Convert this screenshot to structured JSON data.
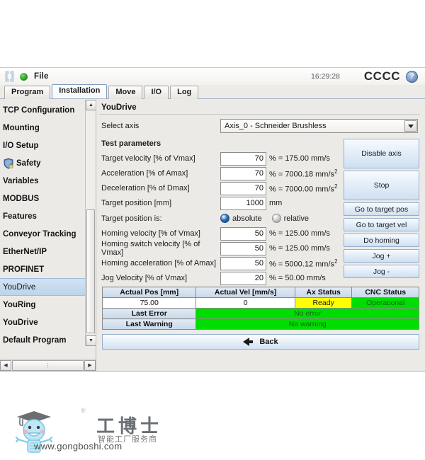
{
  "titlebar": {
    "file_menu": "File",
    "clock": "16:29:28",
    "brand": "CCCC",
    "help_glyph": "?"
  },
  "tabs": [
    {
      "label": "Program",
      "active": false
    },
    {
      "label": "Installation",
      "active": true
    },
    {
      "label": "Move",
      "active": false
    },
    {
      "label": "I/O",
      "active": false
    },
    {
      "label": "Log",
      "active": false
    }
  ],
  "sidebar": {
    "items": [
      {
        "label": "TCP Configuration",
        "icon": "",
        "selected": false
      },
      {
        "label": "Mounting",
        "icon": "",
        "selected": false
      },
      {
        "label": "I/O Setup",
        "icon": "",
        "selected": false
      },
      {
        "label": "Safety",
        "icon": "shield-lock-icon",
        "selected": false
      },
      {
        "label": "Variables",
        "icon": "",
        "selected": false
      },
      {
        "label": "MODBUS",
        "icon": "",
        "selected": false
      },
      {
        "label": "Features",
        "icon": "",
        "selected": false
      },
      {
        "label": "Conveyor Tracking",
        "icon": "",
        "selected": false
      },
      {
        "label": "EtherNet/IP",
        "icon": "",
        "selected": false
      },
      {
        "label": "PROFINET",
        "icon": "",
        "selected": false
      },
      {
        "label": "YouDrive",
        "icon": "",
        "selected": true
      },
      {
        "label": "YouRing",
        "icon": "",
        "selected": false
      },
      {
        "label": "YouDrive",
        "icon": "",
        "selected": false
      },
      {
        "label": "Default Program",
        "icon": "",
        "selected": false
      }
    ],
    "scroll_up_glyph": "▲",
    "scroll_down_glyph": "▼",
    "scroll_left_glyph": "◀",
    "scroll_right_glyph": "▶"
  },
  "panel": {
    "title": "YouDrive",
    "select_axis_label": "Select axis",
    "selected_axis": "Axis_0 - Schneider Brushless",
    "test_parameters_label": "Test parameters",
    "rows": [
      {
        "label": "Target velocity [% of Vmax]",
        "value": "70",
        "unit_prefix": "% = 175.00 mm/s",
        "sup": ""
      },
      {
        "label": "Acceleration [% of Amax]",
        "value": "70",
        "unit_prefix": "% = 7000.18 mm/s",
        "sup": "2"
      },
      {
        "label": "Deceleration [% of Dmax]",
        "value": "70",
        "unit_prefix": "% = 7000.00 mm/s",
        "sup": "2"
      },
      {
        "label": "Target position [mm]",
        "value": "1000",
        "unit_prefix": "mm",
        "sup": ""
      }
    ],
    "target_position_is_label": "Target position is:",
    "radio_absolute": "absolute",
    "radio_relative": "relative",
    "rows2": [
      {
        "label": "Homing velocity [% of Vmax]",
        "value": "50",
        "unit_prefix": "% = 125.00 mm/s",
        "sup": ""
      },
      {
        "label": "Homing switch velocity [% of Vmax]",
        "value": "50",
        "unit_prefix": "% = 125.00 mm/s",
        "sup": ""
      },
      {
        "label": "Homing acceleration [% of Amax]",
        "value": "50",
        "unit_prefix": "% = 5000.12 mm/s",
        "sup": "2"
      },
      {
        "label": "Jog Velocity [% of Vmax]",
        "value": "20",
        "unit_prefix": "% = 50.00 mm/s",
        "sup": ""
      }
    ]
  },
  "buttons": [
    {
      "label": "Disable axis",
      "size": "tall"
    },
    {
      "label": "Stop",
      "size": "tall"
    },
    {
      "label": "Go to target pos",
      "size": "short"
    },
    {
      "label": "Go to target vel",
      "size": "short"
    },
    {
      "label": "Do homing",
      "size": "short"
    },
    {
      "label": "Jog +",
      "size": "short"
    },
    {
      "label": "Jog -",
      "size": "short"
    }
  ],
  "status_table": {
    "headers": [
      "Actual Pos [mm]",
      "Actual Vel [mm/s]",
      "Ax Status",
      "CNC Status"
    ],
    "values": [
      {
        "text": "75.00",
        "state": "white"
      },
      {
        "text": "0",
        "state": "white"
      },
      {
        "text": "Ready",
        "state": "yellow"
      },
      {
        "text": "Operational",
        "state": "green"
      }
    ],
    "last_error_label": "Last Error",
    "last_error_value": "No error",
    "last_warning_label": "Last Warning",
    "last_warning_value": "No warning"
  },
  "back_button": {
    "label": "Back"
  },
  "watermark": {
    "url": "www.gongboshi.com",
    "cn_name": "工博士",
    "cn_sub": "智能工厂服务商",
    "registered": "®"
  },
  "colors": {
    "accent_blue": "#bcd4ec",
    "status_ok_green": "#00dd00",
    "status_ready_yellow": "#ffff00",
    "window_bg": "#eceae6"
  }
}
